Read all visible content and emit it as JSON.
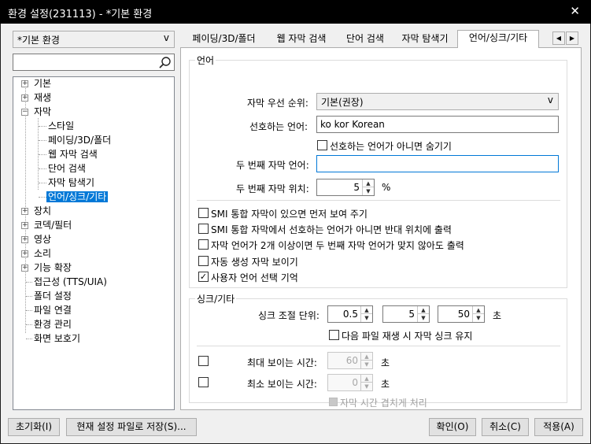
{
  "window": {
    "title": "환경 설정(231113) - *기본 환경",
    "close_glyph": "✕"
  },
  "preset": {
    "value": "*기본 환경",
    "arrow": "v"
  },
  "search": {
    "value": "",
    "icon": "search-icon"
  },
  "tree": {
    "items": [
      {
        "label": "기본",
        "expander": "+"
      },
      {
        "label": "재생",
        "expander": "+"
      },
      {
        "label": "자막",
        "expander": "−"
      },
      {
        "label": "스타일"
      },
      {
        "label": "페이딩/3D/폴더"
      },
      {
        "label": "웹 자막 검색"
      },
      {
        "label": "단어 검색"
      },
      {
        "label": "자막 탐색기"
      },
      {
        "label": "언어/싱크/기타"
      },
      {
        "label": "장치",
        "expander": "+"
      },
      {
        "label": "코덱/필터",
        "expander": "+"
      },
      {
        "label": "영상",
        "expander": "+"
      },
      {
        "label": "소리",
        "expander": "+"
      },
      {
        "label": "기능 확장",
        "expander": "+"
      },
      {
        "label": "접근성 (TTS/UIA)"
      },
      {
        "label": "폴더 설정"
      },
      {
        "label": "파일 연결"
      },
      {
        "label": "환경 관리"
      },
      {
        "label": "화면 보호기"
      }
    ]
  },
  "tabs": [
    "페이딩/3D/폴더",
    "웹 자막 검색",
    "단어 검색",
    "자막 탐색기",
    "언어/싱크/기타"
  ],
  "tab_scroll": {
    "left": "◀",
    "right": "▶"
  },
  "language": {
    "group_title": "언어",
    "priority_label": "자막 우선 순위:",
    "priority_value": "기본(권장)",
    "priority_arrow": "v",
    "preferred_label": "선호하는 언어:",
    "preferred_value": "ko kor Korean",
    "hide_label": "선호하는 언어가 아니면 숨기기",
    "second_lang_label": "두 번째 자막 언어:",
    "second_lang_value": "",
    "second_pos_label": "두 번째 자막 위치:",
    "second_pos_value": "5",
    "second_pos_unit": "%",
    "options": [
      {
        "label": "SMI 통합 자막이 있으면 먼저 보여 주기",
        "checked": false
      },
      {
        "label": "SMI 통합 자막에서 선호하는 언어가 아니면 반대 위치에 출력",
        "checked": false
      },
      {
        "label": "자막 언어가 2개 이상이면 두 번째 자막 언어가 맞지 않아도 출력",
        "checked": false
      },
      {
        "label": "자동 생성 자막 보이기",
        "checked": false
      },
      {
        "label": "사용자 언어 선택 기억",
        "checked": true
      }
    ]
  },
  "sync": {
    "group_title": "싱크/기타",
    "unit_label": "싱크 조절 단위:",
    "unit_values": [
      "0.5",
      "5",
      "50"
    ],
    "unit_suffix": "초",
    "keep_label": "다음 파일 재생 시 자막 싱크 유지",
    "max_label": "최대 보이는 시간:",
    "max_value": "60",
    "max_unit": "초",
    "min_label": "최소 보이는 시간:",
    "min_value": "0",
    "min_unit": "초",
    "overlap_label": "자막 시간 겹치게 처리"
  },
  "spin_glyphs": {
    "up": "▲",
    "down": "▼"
  },
  "check_glyph": "✓",
  "buttons": {
    "reset": "초기화(I)",
    "save_current": "현재 설정 파일로 저장(S)...",
    "ok": "확인(O)",
    "cancel": "취소(C)",
    "apply": "적용(A)"
  },
  "colors": {
    "selection": "#0078d7",
    "titlebar": "#000000"
  }
}
